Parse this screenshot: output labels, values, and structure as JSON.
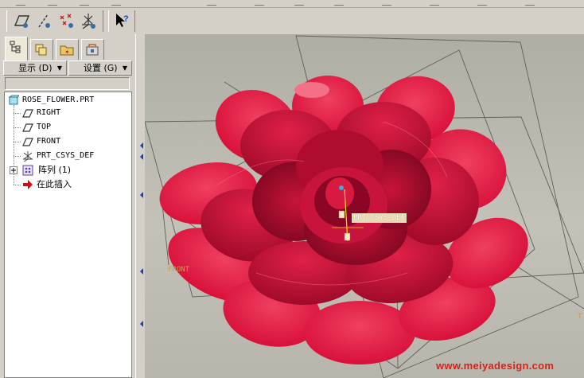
{
  "toolbar": {
    "buttons": [
      {
        "name": "plane-tool-icon"
      },
      {
        "name": "axis-tool-icon"
      },
      {
        "name": "point-tool-icon"
      },
      {
        "name": "csys-tool-icon"
      },
      {
        "name": "whats-this-help-icon"
      }
    ]
  },
  "panel": {
    "tabs": [
      "model-tree-tab",
      "folder-browser-tab",
      "favorites-tab",
      "connections-tab"
    ],
    "menu_show": "显示 (D)",
    "menu_settings": "设置 (G)",
    "search_value": ""
  },
  "tree": {
    "root": "ROSE_FLOWER.PRT",
    "items": [
      {
        "label": "RIGHT",
        "icon": "datum-plane-icon"
      },
      {
        "label": "TOP",
        "icon": "datum-plane-icon"
      },
      {
        "label": "FRONT",
        "icon": "datum-plane-icon"
      },
      {
        "label": "PRT_CSYS_DEF",
        "icon": "csys-icon"
      },
      {
        "label": "阵列 (1)",
        "icon": "pattern-icon"
      },
      {
        "label": "在此插入",
        "icon": "insert-here-arrow-icon"
      }
    ]
  },
  "viewport": {
    "csys_label": "PRT_CSYS_DEF",
    "front_label": "FRONT",
    "corner_label": "T",
    "flower_color": "#e8193e",
    "background": "#b8b6ac"
  },
  "watermark": "www.meiyadesign.com"
}
